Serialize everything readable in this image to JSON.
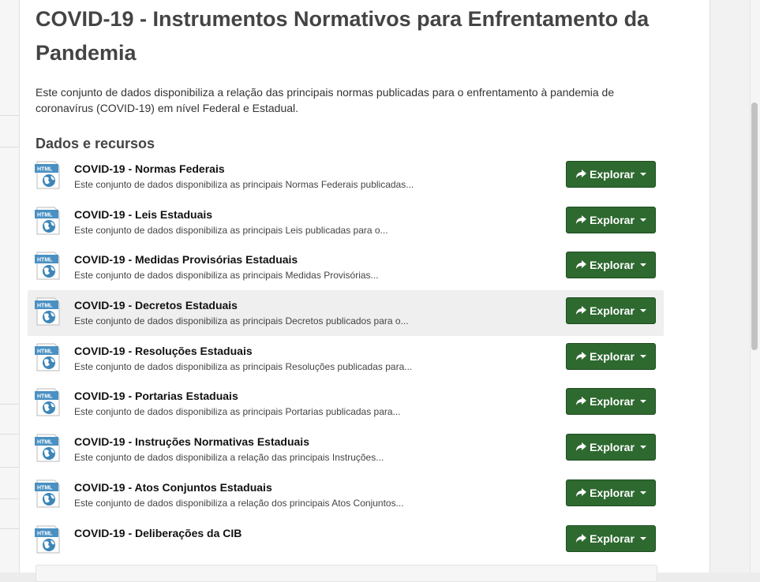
{
  "page": {
    "title": "COVID-19 - Instrumentos Normativos para Enfrentamento da Pandemia",
    "notes": "Este conjunto de dados disponibiliza a relação das principais normas publicadas para o enfrentamento à pandemia de coronavírus (COVID-19) em nível Federal e Estadual.",
    "resources_heading": "Dados e recursos"
  },
  "resources": [
    {
      "title": "COVID-19 - Normas Federais",
      "description": "Este conjunto de dados disponibiliza as principais Normas Federais publicadas...",
      "format": "HTML",
      "button": "Explorar"
    },
    {
      "title": "COVID-19 - Leis Estaduais",
      "description": "Este conjunto de dados disponibiliza as principais Leis publicadas para o...",
      "format": "HTML",
      "button": "Explorar"
    },
    {
      "title": "COVID-19 - Medidas Provisórias Estaduais",
      "description": "Este conjunto de dados disponibiliza as principais Medidas Provisórias...",
      "format": "HTML",
      "button": "Explorar"
    },
    {
      "title": "COVID-19 - Decretos Estaduais",
      "description": "Este conjunto de dados disponibiliza as principais Decretos publicados para o...",
      "format": "HTML",
      "button": "Explorar"
    },
    {
      "title": "COVID-19 - Resoluções Estaduais",
      "description": "Este conjunto de dados disponibiliza as principais Resoluções publicadas para...",
      "format": "HTML",
      "button": "Explorar"
    },
    {
      "title": "COVID-19 - Portarias Estaduais",
      "description": "Este conjunto de dados disponibiliza as principais Portarias publicadas para...",
      "format": "HTML",
      "button": "Explorar"
    },
    {
      "title": "COVID-19 - Instruções Normativas Estaduais",
      "description": "Este conjunto de dados disponibiliza a relação das principais Instruções...",
      "format": "HTML",
      "button": "Explorar"
    },
    {
      "title": "COVID-19 - Atos Conjuntos Estaduais",
      "description": "Este conjunto de dados disponibiliza a relação dos principais Atos Conjuntos...",
      "format": "HTML",
      "button": "Explorar"
    },
    {
      "title": "COVID-19 - Deliberações da CIB",
      "description": "",
      "format": "HTML",
      "button": "Explorar"
    }
  ],
  "icons": {
    "format_icon": "html-file-globe-icon",
    "explore_icon": "share-arrow-icon",
    "dropdown_icon": "caret-down-icon"
  },
  "colors": {
    "explore_button": "#2e6930",
    "format_badge": "#4a90c2",
    "highlight_row": "#efefef"
  }
}
